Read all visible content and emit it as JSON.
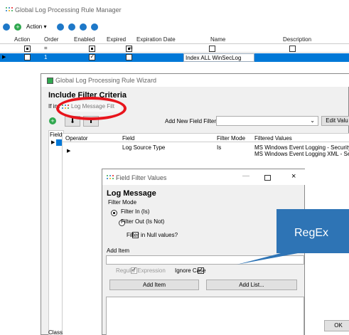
{
  "main_window": {
    "title": "Global Log Processing Rule Manager",
    "toolbar": {
      "action_label": "Action"
    },
    "grid": {
      "columns": [
        "Action",
        "Order",
        "Enabled",
        "Expired",
        "Expiration Date",
        "Name",
        "Description"
      ],
      "filter_row": {
        "order": "=",
        "expiration": "="
      },
      "row": {
        "order": "1",
        "name": "Index ALL WinSecLog"
      }
    }
  },
  "wizard": {
    "title": "Global Log Processing Rule Wizard",
    "heading": "Include Filter Criteria",
    "subtext": "If inc",
    "add_filter_label": "Add New Field Filter:",
    "edit_button": "Edit Valu",
    "left_col_label": "Field",
    "columns": [
      "Operator",
      "Field",
      "Filter Mode",
      "Filtered Values"
    ],
    "row": {
      "field": "Log Source Type",
      "mode": "Is",
      "values": [
        "MS Windows Event Logging - Security",
        "MS Windows Event Logging XML - Secur"
      ]
    },
    "bottom_label": "Class",
    "ok_button": "OK"
  },
  "log_message_tab": {
    "label": "Log Message Filt"
  },
  "dialog": {
    "title": "Field Filter Values",
    "heading": "Log Message",
    "filter_mode_label": "Filter Mode",
    "radio_in": "Filter In (Is)",
    "radio_out": "Filter Out (Is Not)",
    "null_checkbox": "Filter in Null values?",
    "add_item_label": "Add Item",
    "regex_label": "Regular Expression",
    "ignore_case_label": "Ignore Case",
    "add_item_button": "Add Item",
    "add_list_button": "Add List..."
  },
  "callout": {
    "text": "RegEx",
    "color": "#2e74b5"
  },
  "colors": {
    "selection": "#0078d7",
    "annotation_red": "#e8141c",
    "icon_green": "#2fa84f",
    "icon_blue": "#1e78c8"
  }
}
